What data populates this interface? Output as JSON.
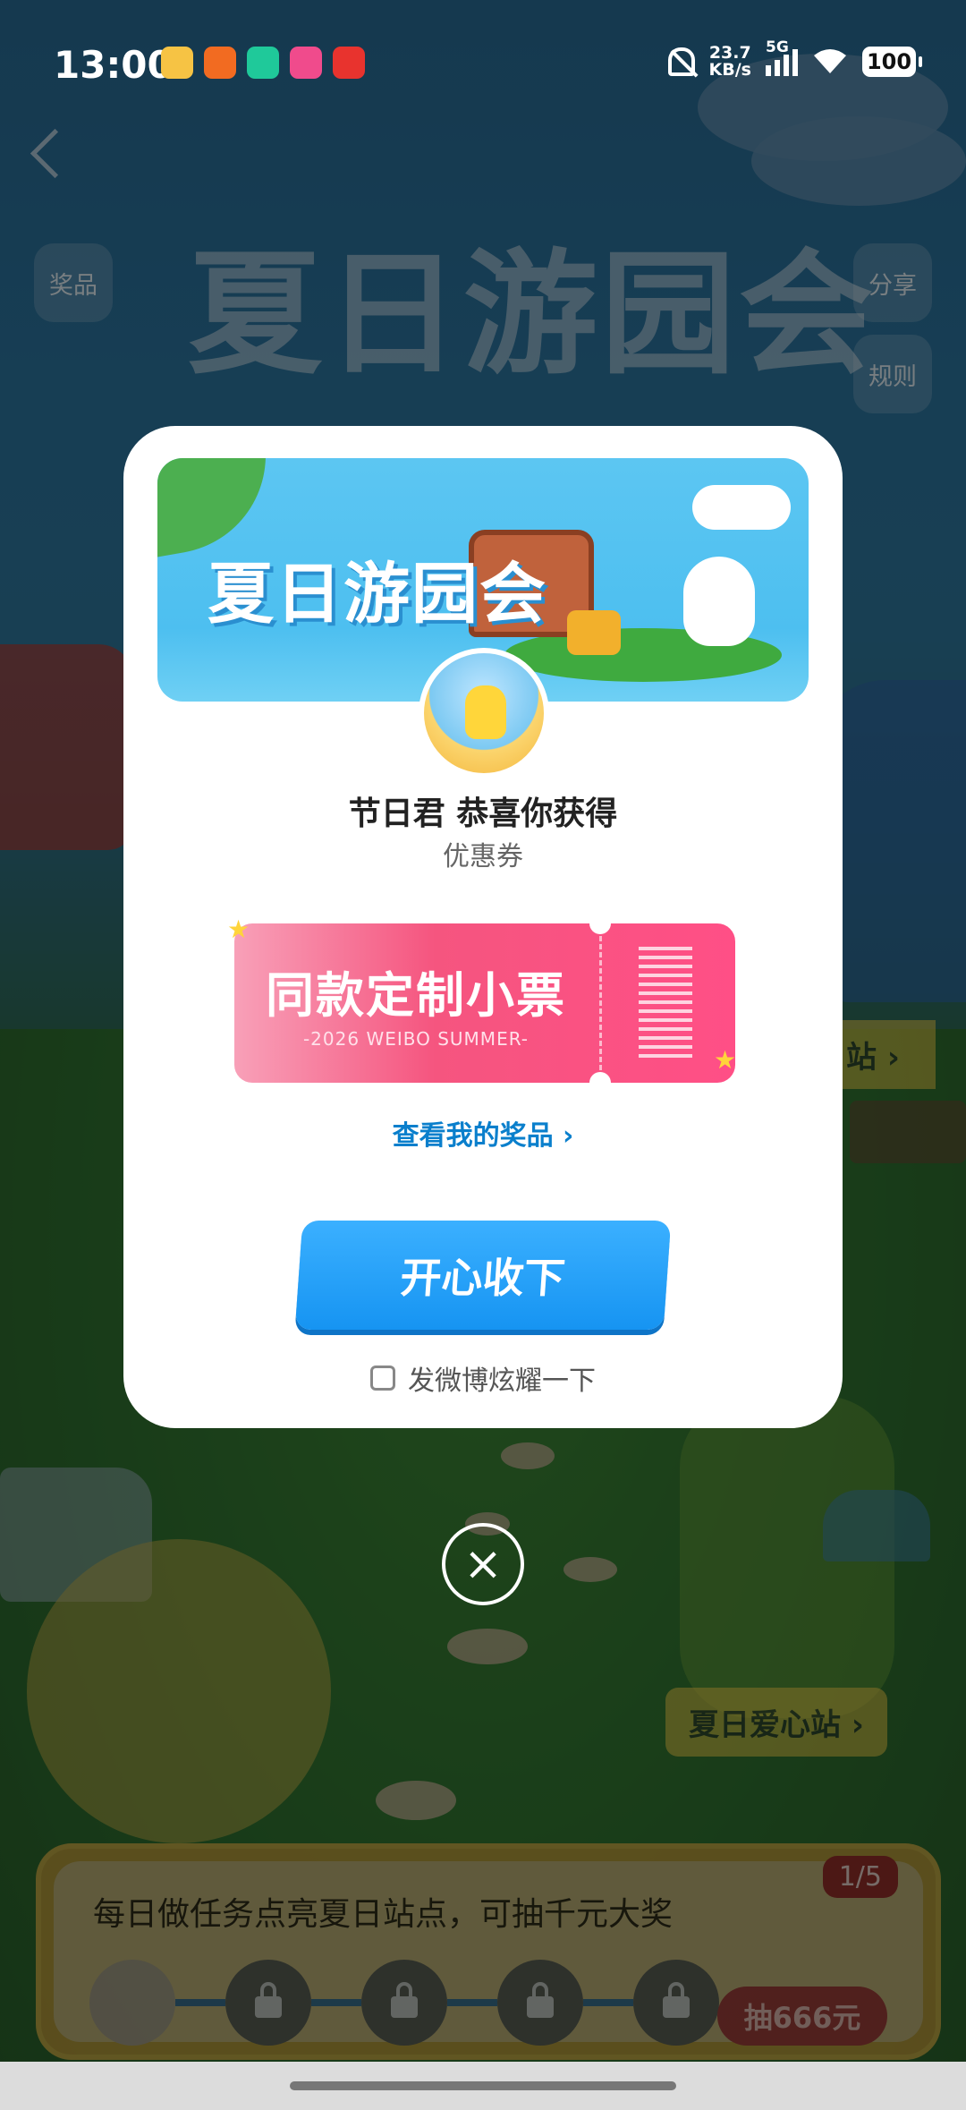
{
  "status_bar": {
    "time": "13:00",
    "net_speed_value": "23.7",
    "net_speed_unit": "KB/s",
    "network_type": "5G",
    "battery": "100",
    "notification_icons": [
      "weibo-icon",
      "taobao-icon",
      "tencent-video-icon",
      "bilibili-icon",
      "netease-music-icon"
    ]
  },
  "background": {
    "title": "夏日游园会",
    "prizes_label": "奖品",
    "share_label": "分享",
    "rules_label": "规则",
    "station_sign_partial": "站",
    "charity_sign": "夏日爱心站",
    "task": {
      "text": "每日做任务点亮夏日站点，可抽千元大奖",
      "progress": "1/5",
      "draw_button": "抽666元"
    }
  },
  "modal": {
    "banner_title": "夏日游园会",
    "congrats": "节日君 恭喜你获得",
    "prize_type": "优惠券",
    "ticket": {
      "title": "同款定制小票",
      "subtitle": "-2026 WEIBO SUMMER-"
    },
    "view_prizes": "查看我的奖品",
    "accept_button": "开心收下",
    "share_checkbox_label": "发微博炫耀一下"
  },
  "colors": {
    "accent_blue": "#1694f2",
    "ticket_pink": "#ff4f86",
    "link_blue": "#0a7fcc"
  }
}
